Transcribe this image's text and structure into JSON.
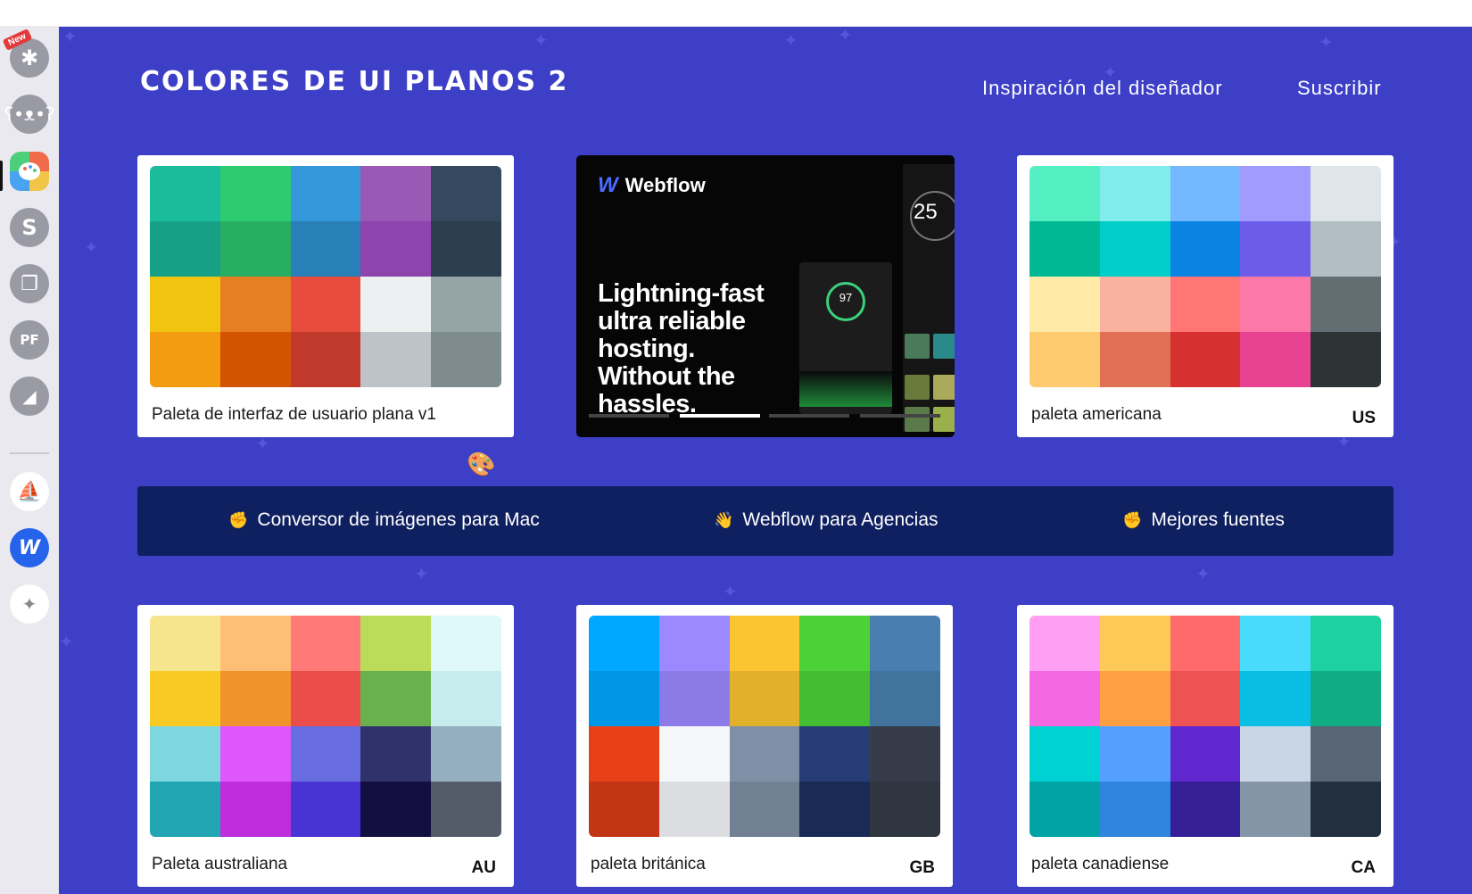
{
  "sidebar": {
    "new_badge": "New",
    "icons": [
      {
        "name": "asterisk-app-icon",
        "glyph": "✱",
        "bg": "#9a9aa4"
      },
      {
        "name": "bear-app-icon",
        "glyph": "ʕ",
        "bg": "#9a9aa4"
      },
      {
        "name": "palette-app-icon",
        "glyph": "",
        "bg": "#e06a4a"
      },
      {
        "name": "s-app-icon",
        "glyph": "S",
        "bg": "#9a9aa4"
      },
      {
        "name": "pages-app-icon",
        "glyph": "❐",
        "bg": "#9a9aa4"
      },
      {
        "name": "pf-app-icon",
        "glyph": "PF",
        "bg": "#9a9aa4"
      },
      {
        "name": "mountain-app-icon",
        "glyph": "◢",
        "bg": "#9a9aa4"
      },
      {
        "name": "blimp-app-icon",
        "glyph": "⛵",
        "bg": "#ffffff"
      },
      {
        "name": "webflow-app-icon",
        "glyph": "W",
        "bg": "#2563eb"
      },
      {
        "name": "add-app-icon",
        "glyph": "✦",
        "bg": "#ffffff"
      }
    ]
  },
  "header": {
    "title": "COLORES DE UI PLANOS 2",
    "nav": [
      "Inspiración del diseñador",
      "Suscribir"
    ]
  },
  "cards": [
    {
      "label": "Paleta de interfaz de usuario plana v1",
      "code": "",
      "colors": [
        "#1abc9c",
        "#2ecc71",
        "#3498db",
        "#9b59b6",
        "#34495e",
        "#16a085",
        "#27ae60",
        "#2980b9",
        "#8e44ad",
        "#2c3e50",
        "#f1c40f",
        "#e67e22",
        "#e74c3c",
        "#ecf0f1",
        "#95a5a6",
        "#f39c12",
        "#d35400",
        "#c0392b",
        "#bdc3c7",
        "#7f8c8d"
      ]
    },
    {
      "label": "paleta americana",
      "code": "US",
      "colors": [
        "#55efc4",
        "#81ecec",
        "#74b9ff",
        "#a29bfe",
        "#dfe6e9",
        "#00b894",
        "#00cec9",
        "#0984e3",
        "#6c5ce7",
        "#b2bec3",
        "#ffeaa7",
        "#fab1a0",
        "#ff7675",
        "#fd79a8",
        "#636e72",
        "#fdcb6e",
        "#e17055",
        "#d63031",
        "#e84393",
        "#2d3436"
      ]
    },
    {
      "label": "Paleta australiana",
      "code": "AU",
      "colors": [
        "#f6e58d",
        "#ffbe76",
        "#ff7979",
        "#badc58",
        "#dff9fb",
        "#f9ca24",
        "#f0932b",
        "#eb4d4b",
        "#6ab04c",
        "#c7ecee",
        "#7ed6df",
        "#e056fd",
        "#686de0",
        "#30336b",
        "#95afc0",
        "#22a6b3",
        "#be2edd",
        "#4834d4",
        "#130f40",
        "#535c68"
      ]
    },
    {
      "label": "paleta británica",
      "code": "GB",
      "colors": [
        "#00a8ff",
        "#9c88ff",
        "#fbc531",
        "#4cd137",
        "#487eb0",
        "#0097e6",
        "#8c7ae6",
        "#e1b12c",
        "#44bd32",
        "#40739e",
        "#e84118",
        "#f5f6fa",
        "#7f8fa6",
        "#273c75",
        "#353b48",
        "#c23616",
        "#dcdde1",
        "#718093",
        "#192a56",
        "#2f3640"
      ]
    },
    {
      "label": "paleta canadiense",
      "code": "CA",
      "colors": [
        "#ff9ff3",
        "#feca57",
        "#ff6b6b",
        "#48dbfb",
        "#1dd1a1",
        "#f368e0",
        "#ff9f43",
        "#ee5253",
        "#0abde3",
        "#10ac84",
        "#00d2d3",
        "#54a0ff",
        "#5f27cd",
        "#c8d6e5",
        "#576574",
        "#01a3a4",
        "#2e86de",
        "#341f97",
        "#8395a7",
        "#222f3e"
      ]
    }
  ],
  "ad": {
    "brand": "Webflow",
    "headline": "Lightning-fast ultra reliable hosting. Without the hassles.",
    "score": "97",
    "side_score": "25"
  },
  "banner": {
    "links": [
      {
        "emoji": "✊",
        "label": "Conversor de imágenes para Mac"
      },
      {
        "emoji": "👋",
        "label": "Webflow para Agencias"
      },
      {
        "emoji": "✊",
        "label": "Mejores fuentes"
      }
    ]
  },
  "colors": {
    "background": "#3d3fc7",
    "banner": "#0f2060",
    "sidebar": "#e9e9ef"
  }
}
